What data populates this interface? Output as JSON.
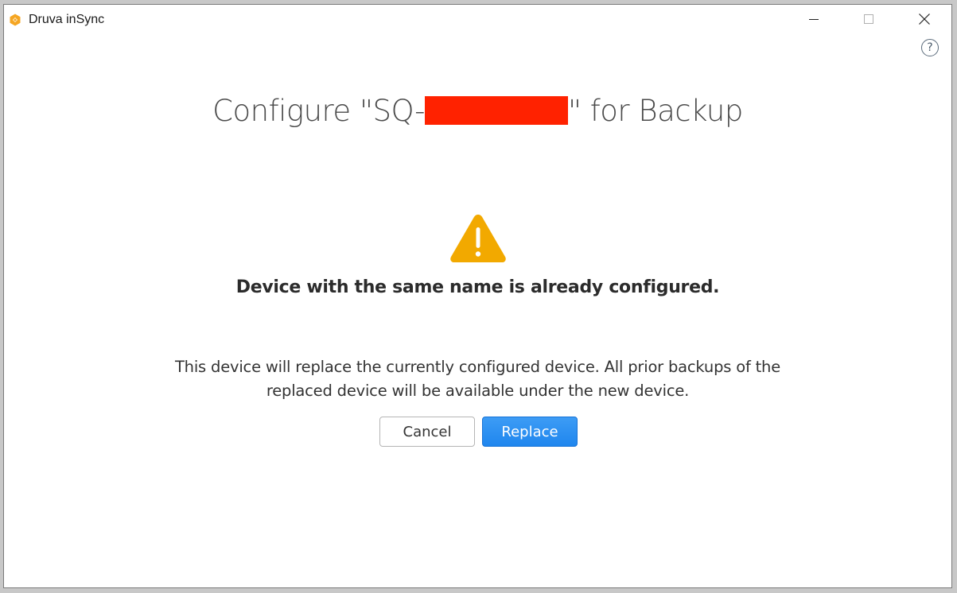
{
  "window": {
    "title": "Druva inSync",
    "controls": {
      "minimize": "minimize-icon",
      "maximize": "maximize-icon",
      "close": "close-icon"
    }
  },
  "help": {
    "label": "?"
  },
  "dialog": {
    "heading_prefix": "Configure \"SQ-",
    "heading_suffix": "\" for Backup",
    "warning_title": "Device with the same name is already configured.",
    "description_line1": "This device will replace the currently configured device. All prior backups of the",
    "description_line2": "replaced device will be available under the new device.",
    "cancel_label": "Cancel",
    "replace_label": "Replace"
  },
  "colors": {
    "accent": "#1f86ee",
    "warning": "#f2a900",
    "redaction": "#ff2200",
    "logo": "#f5a623"
  }
}
